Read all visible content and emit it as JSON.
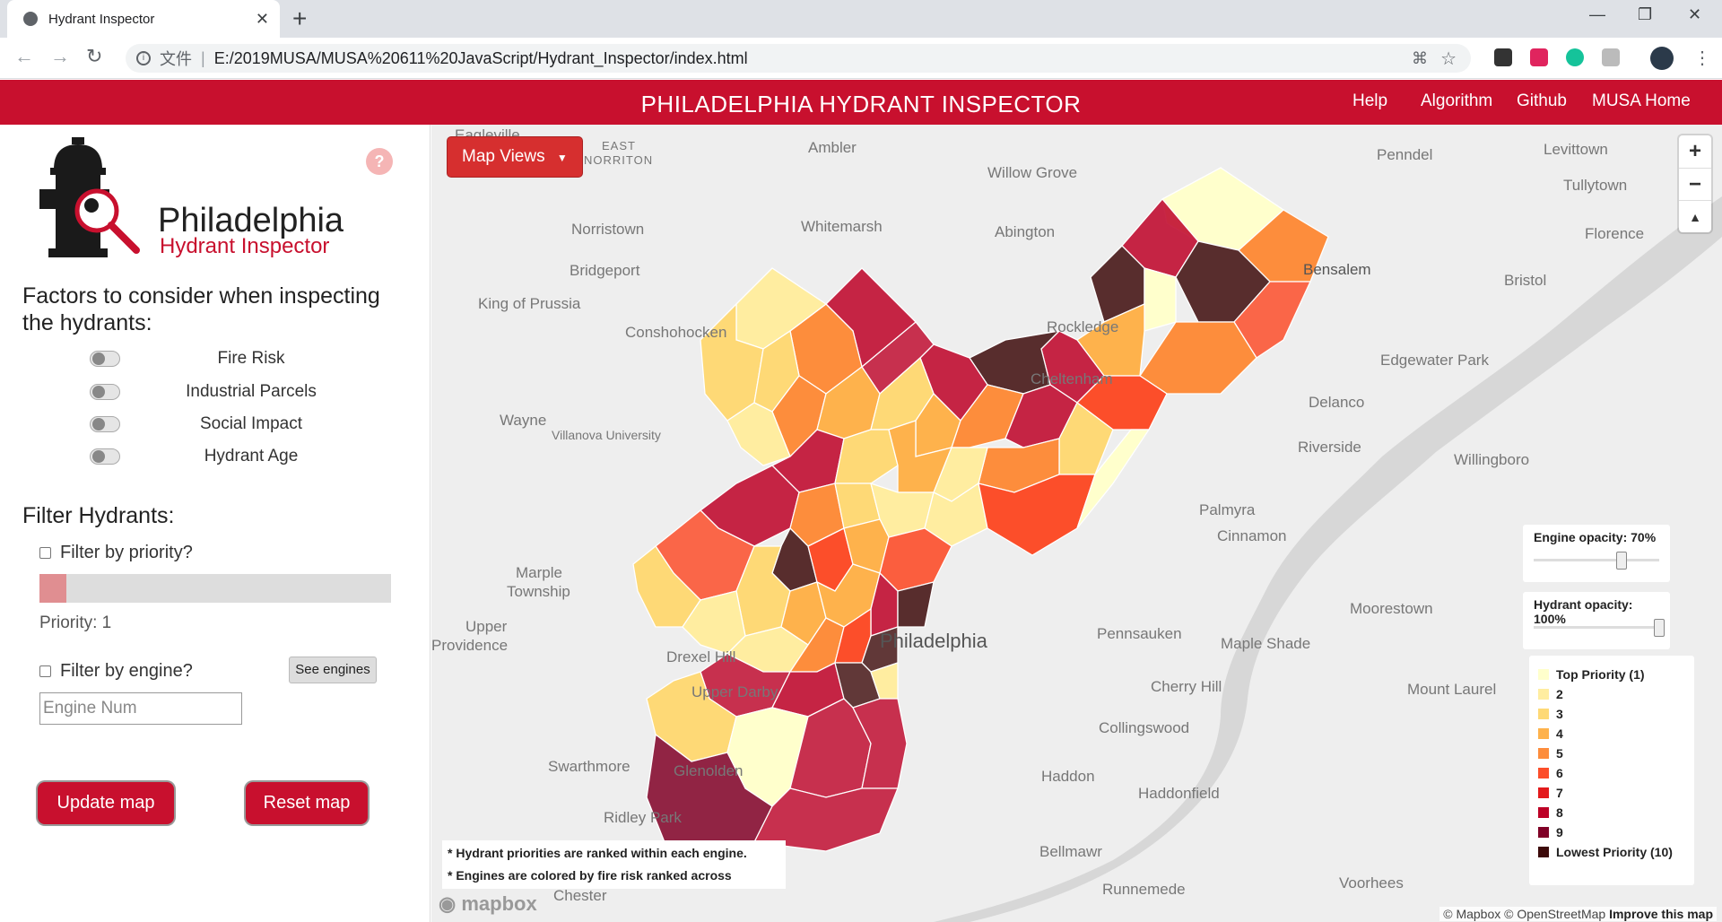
{
  "browser": {
    "tab_title": "Hydrant Inspector",
    "file_label": "文件",
    "separator": "|",
    "url": "E:/2019MUSA/MUSA%20611%20JavaScript/Hydrant_Inspector/index.html"
  },
  "app": {
    "title": "PHILADELPHIA HYDRANT INSPECTOR",
    "nav": [
      "Help",
      "Algorithm",
      "Github",
      "MUSA Home"
    ]
  },
  "sidebar": {
    "help_symbol": "?",
    "logo_line1": "Philadelphia",
    "logo_line2": "Hydrant Inspector",
    "factors_title": "Factors to consider when inspecting the hydrants:",
    "factors": [
      "Fire Risk",
      "Industrial Parcels",
      "Social Impact",
      "Hydrant Age"
    ],
    "filter_title": "Filter Hydrants:",
    "filter_priority_label": "Filter by priority?",
    "priority_text": "Priority: 1",
    "priority_value": 1,
    "filter_engine_label": "Filter by engine?",
    "see_engines_label": "See engines",
    "engine_placeholder": "Engine Num",
    "update_label": "Update map",
    "reset_label": "Reset map"
  },
  "map": {
    "map_views_label": "Map Views",
    "zoom_in": "+",
    "zoom_out": "−",
    "compass": "▲",
    "engine_opacity_label": "Engine opacity: 70%",
    "engine_opacity_value": 0.7,
    "hydrant_opacity_label": "Hydrant opacity: 100%",
    "hydrant_opacity_value": 1.0,
    "legend": [
      {
        "label": "Top Priority (1)",
        "color": "#ffffcc"
      },
      {
        "label": "2",
        "color": "#ffeda0"
      },
      {
        "label": "3",
        "color": "#fed976"
      },
      {
        "label": "4",
        "color": "#feb24c"
      },
      {
        "label": "5",
        "color": "#fd8d3c"
      },
      {
        "label": "6",
        "color": "#fc4e2a"
      },
      {
        "label": "7",
        "color": "#e31a1c"
      },
      {
        "label": "8",
        "color": "#bd0026"
      },
      {
        "label": "9",
        "color": "#800026"
      },
      {
        "label": "Lowest Priority (10)",
        "color": "#3d0a0a"
      }
    ],
    "notes": [
      "* Hydrant priorities are ranked within each engine.",
      "* Engines are colored by fire risk ranked across"
    ],
    "place_labels": [
      "Eagleville",
      "EAST",
      "NORRITON",
      "Ambler",
      "Penndel",
      "Levittown",
      "Willow Grove",
      "Tullytown",
      "Norristown",
      "Whitemarsh",
      "Abington",
      "Florence",
      "Bridgeport",
      "Bensalem",
      "Bristol",
      "King of Prussia",
      "Conshohocken",
      "Rockledge",
      "Edgewater Park",
      "Cheltenham",
      "Delanco",
      "Wayne",
      "Villanova University",
      "Riverside",
      "Willingboro",
      "Palmyra",
      "Cinnamon",
      "Marple",
      "Township",
      "Moorestown",
      "Upper",
      "Providence",
      "Philadelphia",
      "Pennsauken",
      "Maple Shade",
      "Drexel Hill",
      "Upper Darby",
      "Cherry Hill",
      "Mount Laurel",
      "Collingswood",
      "Swarthmore",
      "Glenolden",
      "Haddon",
      "Haddonfield",
      "Ridley Park",
      "Bellmawr",
      "Runnemede",
      "Voorhees",
      "Chester"
    ],
    "logo_text": "mapbox",
    "attribution_text": "© Mapbox © OpenStreetMap",
    "attribution_link": "Improve this map"
  }
}
